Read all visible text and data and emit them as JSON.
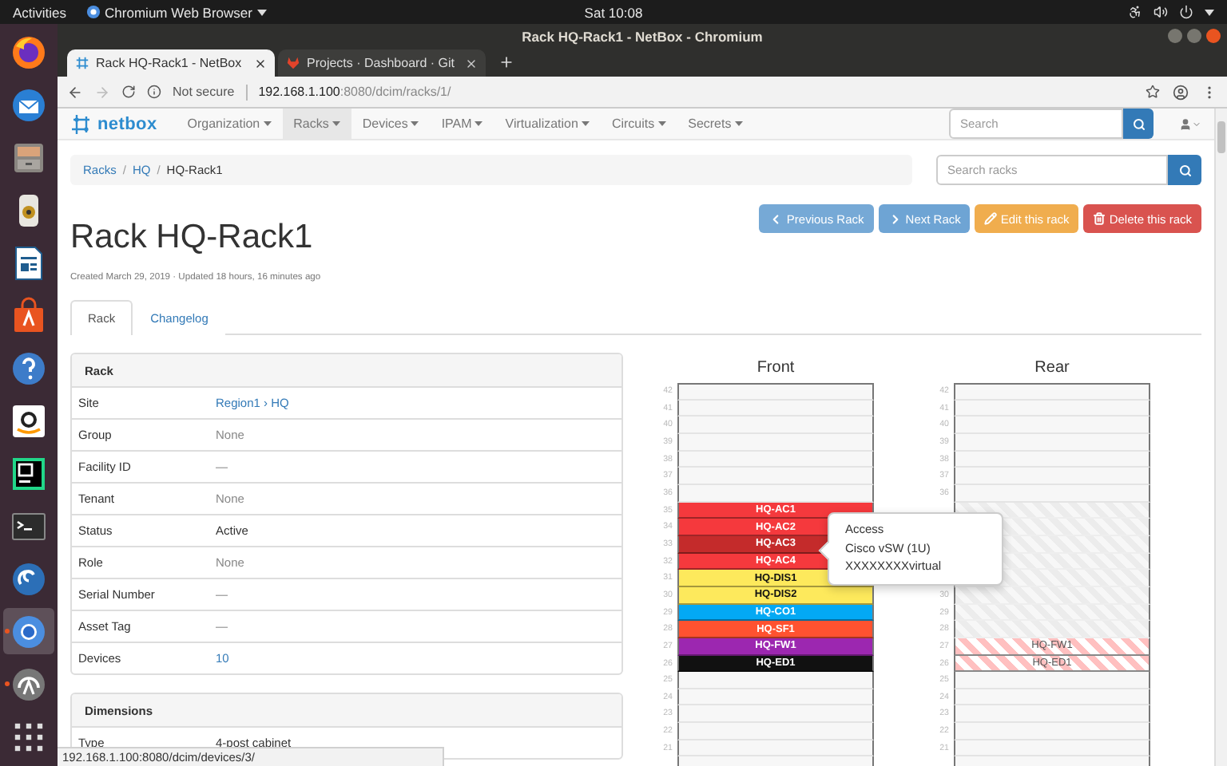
{
  "top_bar": {
    "activities": "Activities",
    "app_menu": "Chromium Web Browser",
    "clock": "Sat 10:08"
  },
  "dock": [
    {
      "kind": "firefox",
      "running": false,
      "active": false
    },
    {
      "kind": "mail",
      "running": false,
      "active": false
    },
    {
      "kind": "files",
      "running": false,
      "active": false
    },
    {
      "kind": "speaker",
      "running": false,
      "active": false
    },
    {
      "kind": "writer",
      "running": false,
      "active": false
    },
    {
      "kind": "store",
      "running": false,
      "active": false
    },
    {
      "kind": "help",
      "running": false,
      "active": false
    },
    {
      "kind": "amazon",
      "running": false,
      "active": false
    },
    {
      "kind": "ide",
      "running": false,
      "active": false
    },
    {
      "kind": "terminal",
      "running": false,
      "active": false
    },
    {
      "kind": "swirl",
      "running": false,
      "active": false
    },
    {
      "kind": "chromium",
      "running": true,
      "active": true
    },
    {
      "kind": "updater",
      "running": true,
      "active": false
    },
    {
      "kind": "grid",
      "running": false,
      "active": false
    }
  ],
  "window": {
    "title": "Rack HQ-Rack1 - NetBox - Chromium"
  },
  "tabs": [
    {
      "label": "Rack HQ-Rack1 - NetBox",
      "selected": true
    },
    {
      "label": "Projects · Dashboard · Git",
      "selected": false
    }
  ],
  "address_bar": {
    "security": "Not secure",
    "host": "192.168.1.100",
    "path": ":8080/dcim/racks/1/"
  },
  "navbar": {
    "brand": "netbox",
    "items": [
      {
        "label": "Organization",
        "selected": false
      },
      {
        "label": "Racks",
        "selected": true
      },
      {
        "label": "Devices",
        "selected": false
      },
      {
        "label": "IPAM",
        "selected": false
      },
      {
        "label": "Virtualization",
        "selected": false
      },
      {
        "label": "Circuits",
        "selected": false
      },
      {
        "label": "Secrets",
        "selected": false
      }
    ],
    "search": {
      "placeholder": "Search"
    }
  },
  "breadcrumb": {
    "separator": "/",
    "items": [
      "Racks",
      "HQ",
      "HQ-Rack1"
    ]
  },
  "rack_search": {
    "placeholder": "Search racks"
  },
  "actions": [
    {
      "label": "Previous Rack",
      "kind": "previous"
    },
    {
      "label": "Next Rack",
      "kind": "next"
    },
    {
      "label": "Edit this rack",
      "kind": "edit"
    },
    {
      "label": "Delete this rack",
      "kind": "delete"
    }
  ],
  "title": "Rack HQ-Rack1",
  "subtitle": "Created March 29, 2019 · Updated 18 hours, 16 minutes ago",
  "page_tabs": [
    {
      "label": "Rack",
      "selected": true
    },
    {
      "label": "Changelog",
      "selected": false
    }
  ],
  "panels": [
    {
      "title": "Rack",
      "rows": [
        {
          "label": "Site",
          "value": "Region1 › HQ",
          "kind": "link"
        },
        {
          "label": "Group",
          "value": "None",
          "kind": "muted"
        },
        {
          "label": "Facility ID",
          "value": "—",
          "kind": "muted"
        },
        {
          "label": "Tenant",
          "value": "None",
          "kind": "muted"
        },
        {
          "label": "Status",
          "value": "Active",
          "kind": "text"
        },
        {
          "label": "Role",
          "value": "None",
          "kind": "muted"
        },
        {
          "label": "Serial Number",
          "value": "—",
          "kind": "muted"
        },
        {
          "label": "Asset Tag",
          "value": "—",
          "kind": "muted"
        },
        {
          "label": "Devices",
          "value": "10",
          "kind": "link"
        }
      ]
    },
    {
      "title": "Dimensions",
      "rows": [
        {
          "label": "Type",
          "value": "4-post cabinet",
          "kind": "text"
        }
      ]
    }
  ],
  "elevations": [
    {
      "title": "Front",
      "units": [
        {
          "number": "42",
          "kind": "empty"
        },
        {
          "number": "41",
          "kind": "empty"
        },
        {
          "number": "40",
          "kind": "empty"
        },
        {
          "number": "39",
          "kind": "empty"
        },
        {
          "number": "38",
          "kind": "empty"
        },
        {
          "number": "37",
          "kind": "empty"
        },
        {
          "number": "36",
          "kind": "empty"
        },
        {
          "number": "35",
          "kind": "device",
          "device": "HQ-AC1",
          "color": "#f5393d"
        },
        {
          "number": "34",
          "kind": "device",
          "device": "HQ-AC2",
          "color": "#f5393d"
        },
        {
          "number": "33",
          "kind": "device",
          "device": "HQ-AC3",
          "color": "#c42b2b"
        },
        {
          "number": "32",
          "kind": "device",
          "device": "HQ-AC4",
          "color": "#f5393d"
        },
        {
          "number": "31",
          "kind": "device",
          "device": "HQ-DIS1",
          "color": "#fde95c"
        },
        {
          "number": "30",
          "kind": "device",
          "device": "HQ-DIS2",
          "color": "#fde95c"
        },
        {
          "number": "29",
          "kind": "device",
          "device": "HQ-CO1",
          "color": "#03a9f4"
        },
        {
          "number": "28",
          "kind": "device",
          "device": "HQ-SF1",
          "color": "#ff5230"
        },
        {
          "number": "27",
          "kind": "device",
          "device": "HQ-FW1",
          "color": "#9c27b0"
        },
        {
          "number": "26",
          "kind": "device",
          "device": "HQ-ED1",
          "color": "#111111"
        },
        {
          "number": "25",
          "kind": "empty"
        },
        {
          "number": "24",
          "kind": "empty"
        },
        {
          "number": "23",
          "kind": "empty"
        },
        {
          "number": "22",
          "kind": "empty"
        },
        {
          "number": "21",
          "kind": "empty"
        }
      ]
    },
    {
      "title": "Rear",
      "units": [
        {
          "number": "42",
          "kind": "empty"
        },
        {
          "number": "41",
          "kind": "empty"
        },
        {
          "number": "40",
          "kind": "empty"
        },
        {
          "number": "39",
          "kind": "empty"
        },
        {
          "number": "38",
          "kind": "empty"
        },
        {
          "number": "37",
          "kind": "empty"
        },
        {
          "number": "36",
          "kind": "empty"
        },
        {
          "kind": "reserved"
        },
        {
          "kind": "reserved"
        },
        {
          "kind": "reserved"
        },
        {
          "kind": "reserved"
        },
        {
          "kind": "reserved"
        },
        {
          "number": "30",
          "kind": "reserved"
        },
        {
          "number": "29",
          "kind": "reserved"
        },
        {
          "number": "28",
          "kind": "reserved"
        },
        {
          "number": "27",
          "kind": "device",
          "device": "HQ-FW1"
        },
        {
          "number": "26",
          "kind": "device",
          "device": "HQ-ED1"
        },
        {
          "number": "25",
          "kind": "empty"
        },
        {
          "number": "24",
          "kind": "empty"
        },
        {
          "number": "23",
          "kind": "empty"
        },
        {
          "number": "22",
          "kind": "empty"
        },
        {
          "number": "21",
          "kind": "empty"
        }
      ]
    }
  ],
  "popover": {
    "lines": [
      "Access",
      "Cisco vSW (1U)",
      "XXXXXXXXvirtual"
    ]
  },
  "status_url": "192.168.1.100:8080/dcim/devices/3/"
}
